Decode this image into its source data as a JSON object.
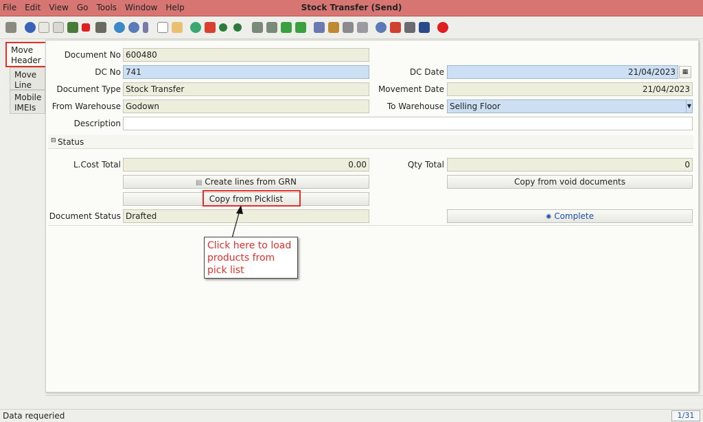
{
  "window": {
    "title": "Stock Transfer (Send)"
  },
  "menu": [
    {
      "label": "File"
    },
    {
      "label": "Edit"
    },
    {
      "label": "View"
    },
    {
      "label": "Go"
    },
    {
      "label": "Tools"
    },
    {
      "label": "Window"
    },
    {
      "label": "Help"
    }
  ],
  "toolbar": {
    "icons": [
      "undo-icon",
      "help-icon",
      "new-icon",
      "copy-icon",
      "save-icon",
      "delete-icon",
      "print-preview-icon",
      "refresh-icon",
      "find-icon",
      "attach-icon",
      "chat-icon",
      "calendar-icon",
      "history-icon",
      "home-icon",
      "previous-icon",
      "next-icon",
      "first-record-icon",
      "previous-record-icon",
      "next-record-icon",
      "last-record-icon",
      "report-icon",
      "archive-icon",
      "print-icon",
      "print-2-icon",
      "zoom-icon",
      "workflow-icon",
      "request-icon",
      "product-icon",
      "close-window-icon"
    ]
  },
  "tabs": [
    {
      "label": "Move\nHeader",
      "active": true
    },
    {
      "label": "Move\nLine"
    },
    {
      "label": "Mobile\nIMEIs"
    }
  ],
  "form": {
    "document_no_label": "Document No",
    "document_no": "600480",
    "dc_no_label": "DC No",
    "dc_no": "741",
    "dc_date_label": "DC Date",
    "dc_date": "21/04/2023",
    "document_type_label": "Document Type",
    "document_type": "Stock Transfer",
    "movement_date_label": "Movement Date",
    "movement_date": "21/04/2023",
    "from_warehouse_label": "From Warehouse",
    "from_warehouse": "Godown",
    "to_warehouse_label": "To Warehouse",
    "to_warehouse": "Selling Floor",
    "description_label": "Description",
    "description": "",
    "status_section": "Status",
    "lcost_total_label": "L.Cost Total",
    "lcost_total": "0.00",
    "qty_total_label": "Qty Total",
    "qty_total": "0",
    "create_lines_button": "Create lines from GRN",
    "copy_void_button": "Copy from void documents",
    "copy_picklist_button": "Copy from Picklist",
    "document_status_label": "Document Status",
    "document_status": "Drafted",
    "complete_button": "Complete"
  },
  "annotation": {
    "text": "Click here to load products from pick list"
  },
  "statusbar": {
    "text": "Data requeried",
    "pager": "1/31"
  },
  "colors": {
    "title_bar": "#d77573",
    "field_blue": "#cddff2",
    "field_beige": "#eeeedd",
    "annotation_red": "#e0302a"
  }
}
